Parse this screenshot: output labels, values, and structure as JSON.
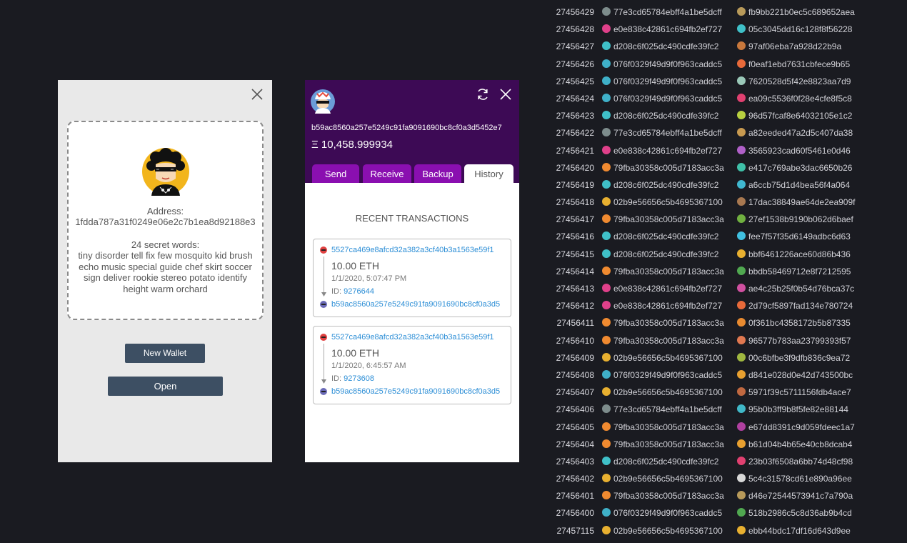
{
  "new_wallet_panel": {
    "address_label": "Address:",
    "address_value": "1fdda787a31f0249e06e2c7b1ea8d92188e3",
    "secret_label": "24 secret words:",
    "secret_words": "tiny disorder tell fix few mosquito kid brush echo music special guide chef skirt soccer sign deliver rookie stereo potato identify height warm orchard",
    "new_wallet_button": "New Wallet",
    "open_button": "Open"
  },
  "wallet_panel": {
    "address": "b59ac8560a257e5249c91fa9091690bc8cf0a3d5452e7",
    "balance": "Ξ 10,458.999934",
    "tabs": [
      "Send",
      "Receive",
      "Backup",
      "History"
    ],
    "active_tab": "History",
    "colors": {
      "header": "#3d0a55",
      "tab": "#8a0fb0",
      "link": "#2c8ed6"
    },
    "recent_title": "RECENT TRANSACTIONS",
    "transactions": [
      {
        "from": "5527ca469e8afcd32a382a3cf40b3a1563e59f1",
        "amount": "10.00 ETH",
        "date": "1/1/2020, 5:07:47 PM",
        "id_label": "ID:",
        "id": "9276644",
        "to": "b59ac8560a257e5249c91fa9091690bc8cf0a3d5"
      },
      {
        "from": "5527ca469e8afcd32a382a3cf40b3a1563e59f1",
        "amount": "10.00 ETH",
        "date": "1/1/2020, 6:45:57 AM",
        "id_label": "ID:",
        "id": "9273608",
        "to": "b59ac8560a257e5249c91fa9091690bc8cf0a3d5"
      }
    ]
  },
  "blocks": [
    {
      "num": "27456429",
      "a": "77e3cd65784ebff4a1be5dcff",
      "b": "fb9bb221b0ec5c689652aea",
      "ca": "#7d8c8c",
      "cb": "#b89a5a"
    },
    {
      "num": "27456428",
      "a": "e0e838c42861c694fb2ef727",
      "b": "05c3045dd16c128f8f56228",
      "ca": "#e0408a",
      "cb": "#3fc0c8"
    },
    {
      "num": "27456427",
      "a": "d208c6f025dc490cdfe39fc2",
      "b": "97af06eba7a928d22b9a",
      "ca": "#3fc0c8",
      "cb": "#c8783c"
    },
    {
      "num": "27456426",
      "a": "076f0329f49d9f0f963caddc5",
      "b": "f0eaf1ebd7631cbfece9b65",
      "ca": "#3fb0c8",
      "cb": "#e86a3a"
    },
    {
      "num": "27456425",
      "a": "076f0329f49d9f0f963caddc5",
      "b": "7620528d5f42e8823aa7d9",
      "ca": "#3fb0c8",
      "cb": "#9ac8b8"
    },
    {
      "num": "27456424",
      "a": "076f0329f49d9f0f963caddc5",
      "b": "ea09c5536f0f28e4cfe8f5c8",
      "ca": "#3fb0c8",
      "cb": "#e04070"
    },
    {
      "num": "27456423",
      "a": "d208c6f025dc490cdfe39fc2",
      "b": "96d57fcaf8e64032105e1c2",
      "ca": "#3fc0c8",
      "cb": "#b8d040"
    },
    {
      "num": "27456422",
      "a": "77e3cd65784ebff4a1be5dcff",
      "b": "a82eeded47a2d5c407da38",
      "ca": "#7d8c8c",
      "cb": "#c89a50"
    },
    {
      "num": "27456421",
      "a": "e0e838c42861c694fb2ef727",
      "b": "3565923cad60f5461e0d46",
      "ca": "#e0408a",
      "cb": "#b060c8"
    },
    {
      "num": "27456420",
      "a": "79fba30358c005d7183acc3a",
      "b": "e417c769abe3dac6650b26",
      "ca": "#f08a30",
      "cb": "#3fc0a8"
    },
    {
      "num": "27456419",
      "a": "d208c6f025dc490cdfe39fc2",
      "b": "a6ccb75d1d4bea56f4a064",
      "ca": "#3fc0c8",
      "cb": "#40b8d0"
    },
    {
      "num": "27456418",
      "a": "02b9e56656c5b4695367100",
      "b": "17dac38849ae64de2ea909f",
      "ca": "#e8b030",
      "cb": "#a87850"
    },
    {
      "num": "27456417",
      "a": "79fba30358c005d7183acc3a",
      "b": "27ef1538b9190b062d6baef",
      "ca": "#f08a30",
      "cb": "#70b040"
    },
    {
      "num": "27456416",
      "a": "d208c6f025dc490cdfe39fc2",
      "b": "fee7f57f35d6149adbc6d63",
      "ca": "#3fc0c8",
      "cb": "#40c0e0"
    },
    {
      "num": "27456415",
      "a": "d208c6f025dc490cdfe39fc2",
      "b": "bbf6461226ace60d86b436",
      "ca": "#3fc0c8",
      "cb": "#e8b030"
    },
    {
      "num": "27456414",
      "a": "79fba30358c005d7183acc3a",
      "b": "bbdb58469712e8f7212595",
      "ca": "#f08a30",
      "cb": "#50a850"
    },
    {
      "num": "27456413",
      "a": "e0e838c42861c694fb2ef727",
      "b": "ae4c25b25f0b54d76bca37c",
      "ca": "#e0408a",
      "cb": "#d050a0"
    },
    {
      "num": "27456412",
      "a": "e0e838c42861c694fb2ef727",
      "b": "2d79cf5897fad134e780724",
      "ca": "#e0408a",
      "cb": "#e86a3a"
    },
    {
      "num": "27456411",
      "a": "79fba30358c005d7183acc3a",
      "b": "0f361bc4358172b5b87335",
      "ca": "#f08a30",
      "cb": "#e88a30"
    },
    {
      "num": "27456410",
      "a": "79fba30358c005d7183acc3a",
      "b": "96577b783aa23799393f57",
      "ca": "#f08a30",
      "cb": "#e07850"
    },
    {
      "num": "27456409",
      "a": "02b9e56656c5b4695367100",
      "b": "00c6bfbe3f9dfb836c9ea72",
      "ca": "#e8b030",
      "cb": "#a0b840"
    },
    {
      "num": "27456408",
      "a": "076f0329f49d9f0f963caddc5",
      "b": "d841e028d0e42d743500bc",
      "ca": "#3fb0c8",
      "cb": "#e8a030"
    },
    {
      "num": "27456407",
      "a": "02b9e56656c5b4695367100",
      "b": "5971f39c5711156fdb4ace7",
      "ca": "#e8b030",
      "cb": "#c06840"
    },
    {
      "num": "27456406",
      "a": "77e3cd65784ebff4a1be5dcff",
      "b": "95b0b3ff9b8f5fe82e88144",
      "ca": "#7d8c8c",
      "cb": "#40b8c8"
    },
    {
      "num": "27456405",
      "a": "79fba30358c005d7183acc3a",
      "b": "e67dd8391c9d059fdeec1a7",
      "ca": "#f08a30",
      "cb": "#b040a0"
    },
    {
      "num": "27456404",
      "a": "79fba30358c005d7183acc3a",
      "b": "b61d04b4b65e40cb8dcab4",
      "ca": "#f08a30",
      "cb": "#e8a030"
    },
    {
      "num": "27456403",
      "a": "d208c6f025dc490cdfe39fc2",
      "b": "23b03f6508a6bb74d48cf98",
      "ca": "#3fc0c8",
      "cb": "#e04070"
    },
    {
      "num": "27456402",
      "a": "02b9e56656c5b4695367100",
      "b": "5c4c31578cd61e890a96ee",
      "ca": "#e8b030",
      "cb": "#d8d8d8"
    },
    {
      "num": "27456401",
      "a": "79fba30358c005d7183acc3a",
      "b": "d46e72544573941c7a790a",
      "ca": "#f08a30",
      "cb": "#b89a5a"
    },
    {
      "num": "27456400",
      "a": "076f0329f49d9f0f963caddc5",
      "b": "518b2986c5c8d36ab9b4cd",
      "ca": "#3fb0c8",
      "cb": "#50a850"
    },
    {
      "num": "27457115",
      "a": "02b9e56656c5b4695367100",
      "b": "ebb44bdc17df16d643d9ee",
      "ca": "#e8b030",
      "cb": "#e8b030"
    }
  ]
}
